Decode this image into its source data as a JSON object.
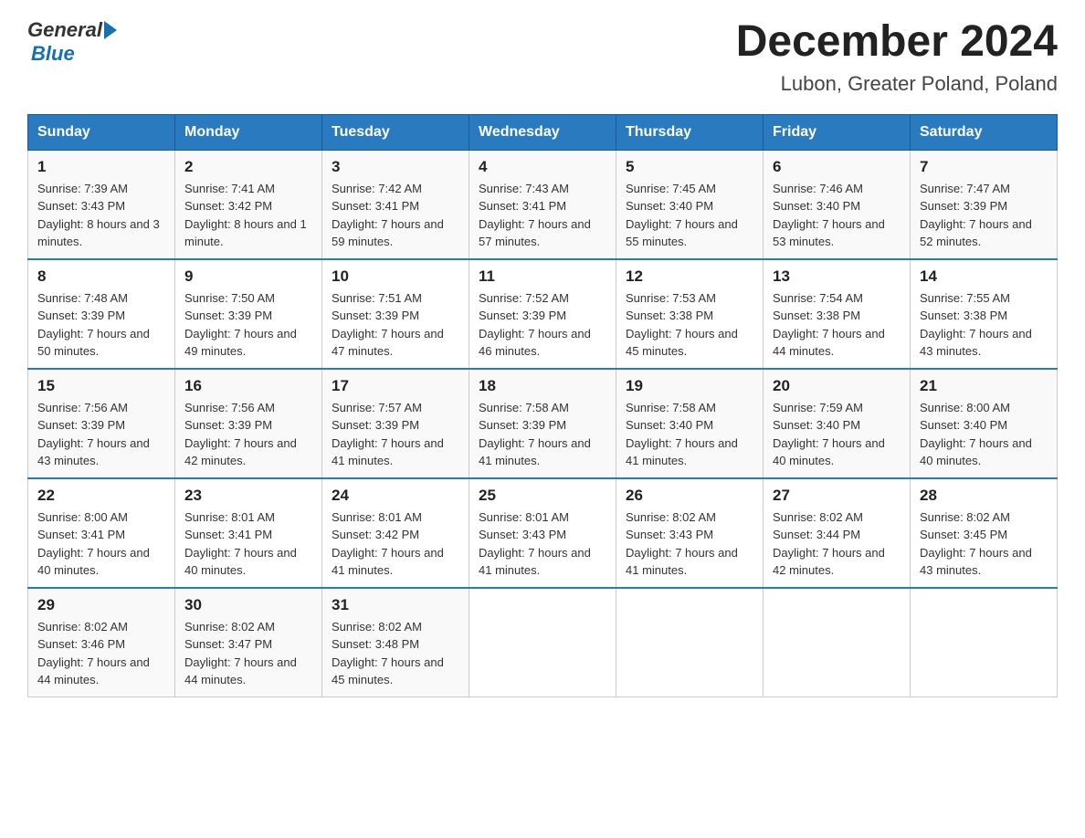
{
  "logo": {
    "general": "General",
    "blue": "Blue"
  },
  "title": "December 2024",
  "location": "Lubon, Greater Poland, Poland",
  "days_of_week": [
    "Sunday",
    "Monday",
    "Tuesday",
    "Wednesday",
    "Thursday",
    "Friday",
    "Saturday"
  ],
  "weeks": [
    [
      {
        "day": "1",
        "sunrise": "7:39 AM",
        "sunset": "3:43 PM",
        "daylight": "8 hours and 3 minutes."
      },
      {
        "day": "2",
        "sunrise": "7:41 AM",
        "sunset": "3:42 PM",
        "daylight": "8 hours and 1 minute."
      },
      {
        "day": "3",
        "sunrise": "7:42 AM",
        "sunset": "3:41 PM",
        "daylight": "7 hours and 59 minutes."
      },
      {
        "day": "4",
        "sunrise": "7:43 AM",
        "sunset": "3:41 PM",
        "daylight": "7 hours and 57 minutes."
      },
      {
        "day": "5",
        "sunrise": "7:45 AM",
        "sunset": "3:40 PM",
        "daylight": "7 hours and 55 minutes."
      },
      {
        "day": "6",
        "sunrise": "7:46 AM",
        "sunset": "3:40 PM",
        "daylight": "7 hours and 53 minutes."
      },
      {
        "day": "7",
        "sunrise": "7:47 AM",
        "sunset": "3:39 PM",
        "daylight": "7 hours and 52 minutes."
      }
    ],
    [
      {
        "day": "8",
        "sunrise": "7:48 AM",
        "sunset": "3:39 PM",
        "daylight": "7 hours and 50 minutes."
      },
      {
        "day": "9",
        "sunrise": "7:50 AM",
        "sunset": "3:39 PM",
        "daylight": "7 hours and 49 minutes."
      },
      {
        "day": "10",
        "sunrise": "7:51 AM",
        "sunset": "3:39 PM",
        "daylight": "7 hours and 47 minutes."
      },
      {
        "day": "11",
        "sunrise": "7:52 AM",
        "sunset": "3:39 PM",
        "daylight": "7 hours and 46 minutes."
      },
      {
        "day": "12",
        "sunrise": "7:53 AM",
        "sunset": "3:38 PM",
        "daylight": "7 hours and 45 minutes."
      },
      {
        "day": "13",
        "sunrise": "7:54 AM",
        "sunset": "3:38 PM",
        "daylight": "7 hours and 44 minutes."
      },
      {
        "day": "14",
        "sunrise": "7:55 AM",
        "sunset": "3:38 PM",
        "daylight": "7 hours and 43 minutes."
      }
    ],
    [
      {
        "day": "15",
        "sunrise": "7:56 AM",
        "sunset": "3:39 PM",
        "daylight": "7 hours and 43 minutes."
      },
      {
        "day": "16",
        "sunrise": "7:56 AM",
        "sunset": "3:39 PM",
        "daylight": "7 hours and 42 minutes."
      },
      {
        "day": "17",
        "sunrise": "7:57 AM",
        "sunset": "3:39 PM",
        "daylight": "7 hours and 41 minutes."
      },
      {
        "day": "18",
        "sunrise": "7:58 AM",
        "sunset": "3:39 PM",
        "daylight": "7 hours and 41 minutes."
      },
      {
        "day": "19",
        "sunrise": "7:58 AM",
        "sunset": "3:40 PM",
        "daylight": "7 hours and 41 minutes."
      },
      {
        "day": "20",
        "sunrise": "7:59 AM",
        "sunset": "3:40 PM",
        "daylight": "7 hours and 40 minutes."
      },
      {
        "day": "21",
        "sunrise": "8:00 AM",
        "sunset": "3:40 PM",
        "daylight": "7 hours and 40 minutes."
      }
    ],
    [
      {
        "day": "22",
        "sunrise": "8:00 AM",
        "sunset": "3:41 PM",
        "daylight": "7 hours and 40 minutes."
      },
      {
        "day": "23",
        "sunrise": "8:01 AM",
        "sunset": "3:41 PM",
        "daylight": "7 hours and 40 minutes."
      },
      {
        "day": "24",
        "sunrise": "8:01 AM",
        "sunset": "3:42 PM",
        "daylight": "7 hours and 41 minutes."
      },
      {
        "day": "25",
        "sunrise": "8:01 AM",
        "sunset": "3:43 PM",
        "daylight": "7 hours and 41 minutes."
      },
      {
        "day": "26",
        "sunrise": "8:02 AM",
        "sunset": "3:43 PM",
        "daylight": "7 hours and 41 minutes."
      },
      {
        "day": "27",
        "sunrise": "8:02 AM",
        "sunset": "3:44 PM",
        "daylight": "7 hours and 42 minutes."
      },
      {
        "day": "28",
        "sunrise": "8:02 AM",
        "sunset": "3:45 PM",
        "daylight": "7 hours and 43 minutes."
      }
    ],
    [
      {
        "day": "29",
        "sunrise": "8:02 AM",
        "sunset": "3:46 PM",
        "daylight": "7 hours and 44 minutes."
      },
      {
        "day": "30",
        "sunrise": "8:02 AM",
        "sunset": "3:47 PM",
        "daylight": "7 hours and 44 minutes."
      },
      {
        "day": "31",
        "sunrise": "8:02 AM",
        "sunset": "3:48 PM",
        "daylight": "7 hours and 45 minutes."
      },
      null,
      null,
      null,
      null
    ]
  ]
}
